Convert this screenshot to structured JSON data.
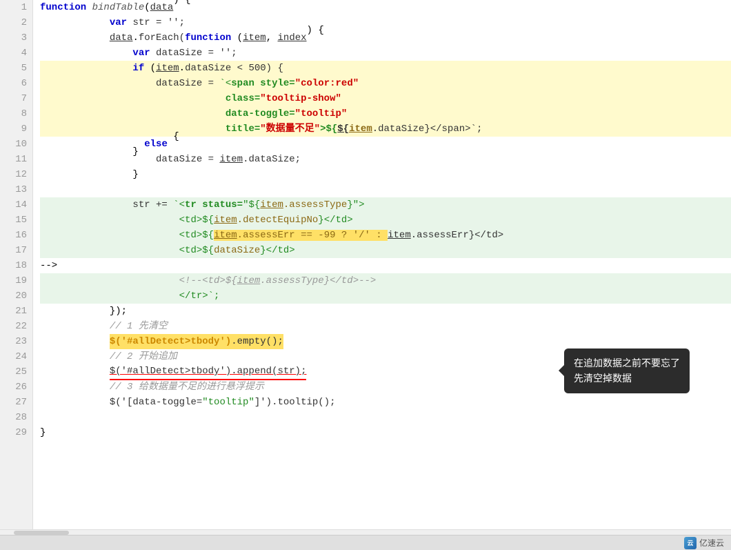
{
  "editor": {
    "lines": [
      {
        "num": 1,
        "type": "normal",
        "indent": 0
      },
      {
        "num": 2,
        "type": "normal",
        "indent": 1
      },
      {
        "num": 3,
        "type": "normal",
        "indent": 1
      },
      {
        "num": 4,
        "type": "normal",
        "indent": 2
      },
      {
        "num": 5,
        "type": "highlighted-yellow",
        "indent": 2
      },
      {
        "num": 6,
        "type": "highlighted-yellow",
        "indent": 3
      },
      {
        "num": 7,
        "type": "highlighted-yellow",
        "indent": 3
      },
      {
        "num": 8,
        "type": "highlighted-yellow",
        "indent": 3
      },
      {
        "num": 9,
        "type": "highlighted-yellow",
        "indent": 3
      },
      {
        "num": 10,
        "type": "normal",
        "indent": 2
      },
      {
        "num": 11,
        "type": "normal",
        "indent": 2
      },
      {
        "num": 12,
        "type": "normal",
        "indent": 2
      },
      {
        "num": 13,
        "type": "normal",
        "indent": 2
      },
      {
        "num": 14,
        "type": "highlighted-green",
        "indent": 2
      },
      {
        "num": 15,
        "type": "highlighted-green",
        "indent": 3
      },
      {
        "num": 16,
        "type": "highlighted-green",
        "indent": 3
      },
      {
        "num": 17,
        "type": "highlighted-green",
        "indent": 3
      },
      {
        "num": 18,
        "type": "highlighted-green",
        "indent": 3
      },
      {
        "num": 19,
        "type": "highlighted-green",
        "indent": 3
      },
      {
        "num": 20,
        "type": "normal",
        "indent": 2
      },
      {
        "num": 21,
        "type": "normal",
        "indent": 1
      },
      {
        "num": 22,
        "type": "normal",
        "indent": 1
      },
      {
        "num": 23,
        "type": "normal",
        "indent": 0
      },
      {
        "num": 24,
        "type": "normal",
        "indent": 1
      },
      {
        "num": 25,
        "type": "normal",
        "indent": 1
      },
      {
        "num": 26,
        "type": "normal",
        "indent": 1
      },
      {
        "num": 27,
        "type": "normal",
        "indent": 1
      },
      {
        "num": 28,
        "type": "normal",
        "indent": 1
      },
      {
        "num": 29,
        "type": "normal",
        "indent": 0
      }
    ]
  },
  "tooltip": {
    "text_line1": "在追加数据之前不要忘了",
    "text_line2": "先清空掉数据"
  },
  "logo": {
    "text": "亿速云",
    "icon": "云"
  }
}
